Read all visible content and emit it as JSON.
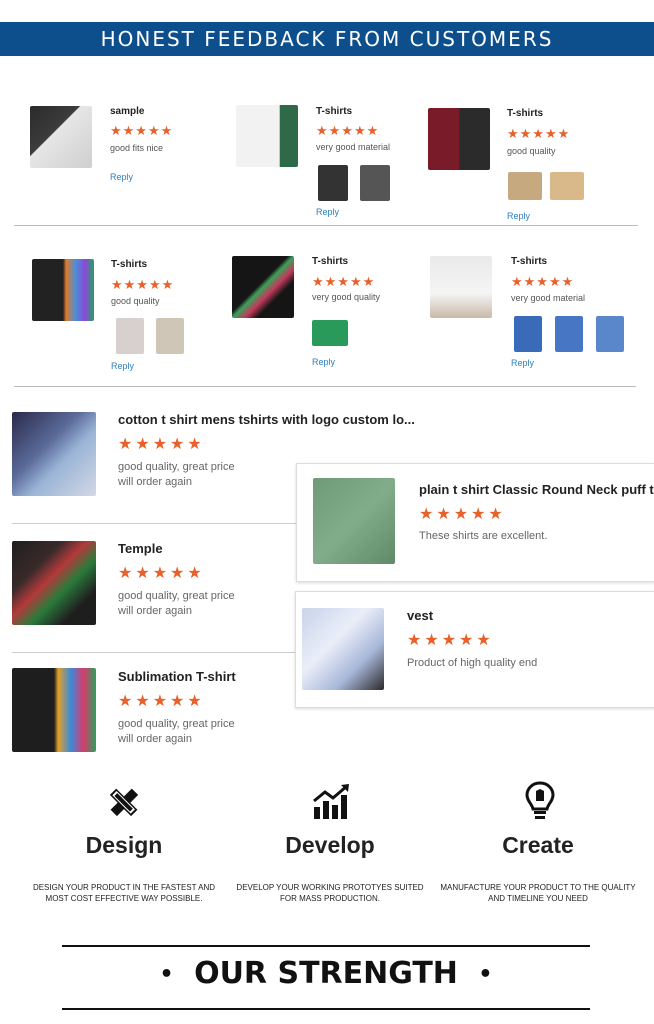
{
  "banner": {
    "title": "HONEST FEEDBACK FROM CUSTOMERS"
  },
  "stars": "★★★★★",
  "reviews_row1": [
    {
      "title": "sample",
      "comment": "good fits nice",
      "reply": "Reply"
    },
    {
      "title": "T-shirts",
      "comment": "very good material",
      "reply": "Reply"
    },
    {
      "title": "T-shirts",
      "comment": "good quality",
      "reply": "Reply"
    }
  ],
  "reviews_row2": [
    {
      "title": "T-shirts",
      "comment": "good quality",
      "reply": "Reply"
    },
    {
      "title": "T-shirts",
      "comment": "very good quality",
      "reply": "Reply"
    },
    {
      "title": "T-shirts",
      "comment": "very good material",
      "reply": "Reply"
    }
  ],
  "product_reviews": [
    {
      "title": "cotton t shirt mens tshirts with logo custom lo...",
      "line1": "good quality,  great price",
      "line2": "will order again"
    },
    {
      "title": "Temple",
      "line1": "good quality,  great price",
      "line2": "will order again"
    },
    {
      "title": "Sublimation T-shirt",
      "line1": "good quality,  great price",
      "line2": "will order again"
    }
  ],
  "product_cards": [
    {
      "title": "plain t shirt Classic Round Neck puff t-sh",
      "text": "These shirts are excellent."
    },
    {
      "title": "vest",
      "text": "Product of high quality end"
    }
  ],
  "features": [
    {
      "icon": "pencil-ruler-icon",
      "title": "Design",
      "desc1": "DESIGN YOUR PRODUCT IN THE FASTEST AND",
      "desc2": "MOST COST EFFECTIVE WAY POSSIBLE."
    },
    {
      "icon": "bar-chart-icon",
      "title": "Develop",
      "desc1": "DEVELOP YOUR WORKING PROTOTYES SUITED",
      "desc2": "FOR MASS PRODUCTION."
    },
    {
      "icon": "lightbulb-icon",
      "title": "Create",
      "desc1": "MANUFACTURE YOUR PRODUCT TO THE QUALITY",
      "desc2": "AND TIMELINE YOU NEED"
    }
  ],
  "strength": {
    "bullet_left": "•",
    "title": "OUR STRENGTH",
    "bullet_right": "•"
  },
  "colors": {
    "banner": "#0d4f8c",
    "star": "#e8602a",
    "reply": "#2d7fc1"
  }
}
